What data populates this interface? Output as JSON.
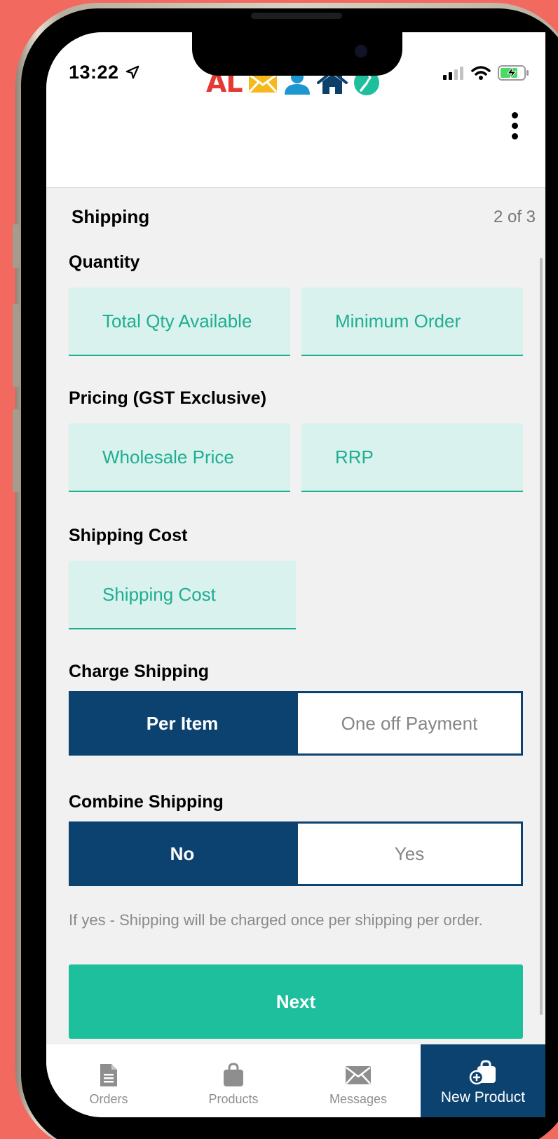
{
  "status": {
    "time": "13:22"
  },
  "header": {
    "logo_text": "AL"
  },
  "page": {
    "title": "Shipping",
    "step": "2 of 3"
  },
  "quantity": {
    "label": "Quantity",
    "total_placeholder": "Total Qty Available",
    "min_placeholder": "Minimum Order"
  },
  "pricing": {
    "label": "Pricing (GST Exclusive)",
    "wholesale_placeholder": "Wholesale Price",
    "rrp_placeholder": "RRP"
  },
  "shipping_cost": {
    "label": "Shipping Cost",
    "placeholder": "Shipping Cost"
  },
  "charge_shipping": {
    "label": "Charge Shipping",
    "options": [
      "Per Item",
      "One off Payment"
    ],
    "selected": "Per Item"
  },
  "combine_shipping": {
    "label": "Combine Shipping",
    "options": [
      "No",
      "Yes"
    ],
    "selected": "No",
    "hint": "If yes - Shipping will be charged once per shipping per order."
  },
  "actions": {
    "next_label": "Next"
  },
  "tabs": [
    {
      "label": "Orders",
      "icon": "document-icon"
    },
    {
      "label": "Products",
      "icon": "bag-icon"
    },
    {
      "label": "Messages",
      "icon": "envelope-icon"
    },
    {
      "label": "New Product",
      "icon": "bag-plus-icon",
      "active": true
    }
  ],
  "colors": {
    "navy": "#0c4270",
    "teal": "#1dbf9c",
    "field_bg": "#d9f2ee",
    "background": "#f26a5f"
  }
}
